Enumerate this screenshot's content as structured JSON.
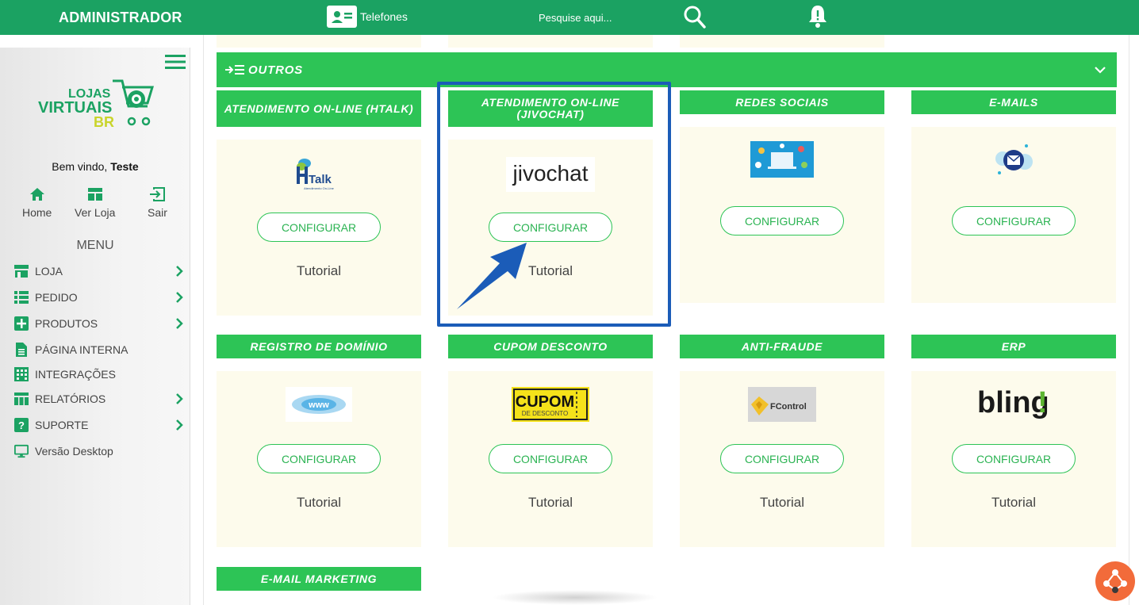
{
  "topbar": {
    "brand": "ADMINISTRADOR",
    "phones_label": "Telefones",
    "search_placeholder": "Pesquise aqui..."
  },
  "sidebar": {
    "logo": {
      "line1": "LOJAS",
      "line2": "VIRTUAIS",
      "line3": "BR"
    },
    "welcome_prefix": "Bem vindo,",
    "welcome_user": "Teste",
    "quick_links": [
      {
        "label": "Home",
        "icon": "home-icon"
      },
      {
        "label": "Ver Loja",
        "icon": "store-grid-icon"
      },
      {
        "label": "Sair",
        "icon": "logout-icon"
      }
    ],
    "menu_title": "MENU",
    "menu_items": [
      {
        "label": "LOJA",
        "icon": "store-icon"
      },
      {
        "label": "PEDIDO",
        "icon": "list-icon"
      },
      {
        "label": "PRODUTOS",
        "icon": "plus-box-icon"
      },
      {
        "label": "PÁGINA INTERNA",
        "icon": "document-icon"
      },
      {
        "label": "INTEGRAÇÕES",
        "icon": "building-icon"
      },
      {
        "label": "RELATÓRIOS",
        "icon": "table-icon"
      },
      {
        "label": "SUPORTE",
        "icon": "help-box-icon"
      },
      {
        "label": "Versão Desktop",
        "icon": "monitor-icon"
      }
    ]
  },
  "section": {
    "title": "OUTROS"
  },
  "cards": [
    {
      "title": "ATENDIMENTO ON-LINE (HTALK)",
      "logo_text": "Talk",
      "logo_sub": "Atendimento On-Line",
      "button": "CONFIGURAR",
      "tutorial": "Tutorial"
    },
    {
      "title": "ATENDIMENTO ON-LINE (JIVOCHAT)",
      "logo_text": "jivochat",
      "button": "CONFIGURAR",
      "tutorial": "Tutorial"
    },
    {
      "title": "REDES SOCIAIS",
      "button": "CONFIGURAR"
    },
    {
      "title": "E-MAILS",
      "button": "CONFIGURAR"
    },
    {
      "title": "REGISTRO DE DOMÍNIO",
      "logo_text": "www",
      "button": "CONFIGURAR",
      "tutorial": "Tutorial"
    },
    {
      "title": "CUPOM DESCONTO",
      "logo_text": "CUPOM",
      "logo_sub": "DE DESCONTO",
      "button": "CONFIGURAR",
      "tutorial": "Tutorial"
    },
    {
      "title": "ANTI-FRAUDE",
      "logo_text": "FControl",
      "button": "CONFIGURAR",
      "tutorial": "Tutorial"
    },
    {
      "title": "ERP",
      "logo_text": "bling",
      "logo_mark": "!",
      "button": "CONFIGURAR",
      "tutorial": "Tutorial"
    },
    {
      "title": "E-MAIL MARKETING"
    }
  ],
  "colors": {
    "topbar": "#1ba262",
    "accent": "#2dc456",
    "card_bg": "#fdfbec",
    "highlight": "#1b5cb8",
    "fab": "#f26b3a"
  }
}
